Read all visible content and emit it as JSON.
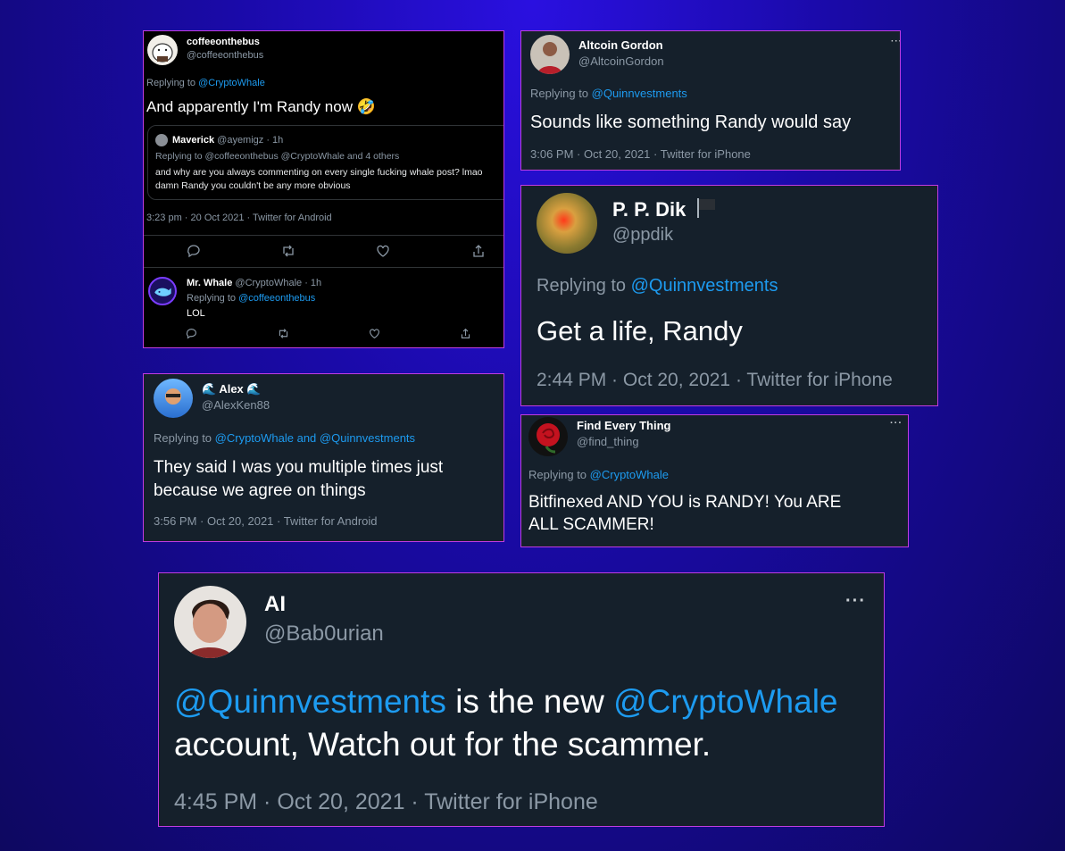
{
  "coffee": {
    "name": "coffeeonthebus",
    "handle": "@coffeeonthebus",
    "replying_prefix": "Replying to ",
    "replying_to": "@CryptoWhale",
    "text": "And apparently I'm Randy now 🤣",
    "quote": {
      "name": "Maverick",
      "meta": "@ayemigz · 1h",
      "replying": "Replying to @coffeeonthebus @CryptoWhale  and 4 others",
      "text_line1": "and why are you always commenting on every single fucking whale post? lmao",
      "text_line2": "damn Randy you couldn't be any more obvious"
    },
    "timestamp": "3:23 pm · 20 Oct 2021 · Twitter for Android",
    "reply": {
      "name": "Mr. Whale",
      "meta": "@CryptoWhale · 1h",
      "replying_prefix": "Replying to ",
      "replying_to": "@coffeeonthebus",
      "text": "LOL"
    }
  },
  "gordon": {
    "name": "Altcoin Gordon",
    "handle": "@AltcoinGordon",
    "more": "···",
    "replying_prefix": "Replying to ",
    "replying_to": "@Quinnvestments",
    "text": "Sounds like something Randy would say",
    "timestamp": "3:06 PM · Oct 20, 2021 · Twitter for iPhone"
  },
  "ppdik": {
    "name": "P. P. Dik",
    "handle": "@ppdik",
    "replying_prefix": "Replying to ",
    "replying_to": "@Quinnvestments",
    "text": "Get a life, Randy",
    "timestamp": "2:44 PM · Oct 20, 2021 · Twitter for iPhone"
  },
  "alex": {
    "name": "Alex",
    "wave": "🌊",
    "handle": "@AlexKen88",
    "replying_prefix": "Replying to ",
    "replying_to": "@CryptoWhale and @Quinnvestments",
    "text_line1": "They said I was you multiple times just",
    "text_line2": "because we agree on things",
    "timestamp": "3:56 PM · Oct 20, 2021 · Twitter for Android"
  },
  "findthing": {
    "name": "Find Every Thing",
    "handle": "@find_thing",
    "more": "···",
    "replying_prefix": "Replying to ",
    "replying_to": "@CryptoWhale",
    "text_line1": "Bitfinexed AND YOU  is RANDY! You ARE",
    "text_line2": "ALL SCAMMER!"
  },
  "ai": {
    "name": "AI",
    "handle": "@Bab0urian",
    "more": "···",
    "mention1": "@Quinnvestments",
    "middle": " is the new ",
    "mention2": "@CryptoWhale",
    "line2": "account, Watch out for the scammer.",
    "timestamp": "4:45 PM · Oct 20, 2021 · Twitter for iPhone"
  },
  "colors": {
    "border": "#c13ce0",
    "card_bg": "#15202b",
    "link": "#1d9bf0",
    "muted": "#8b98a5"
  }
}
